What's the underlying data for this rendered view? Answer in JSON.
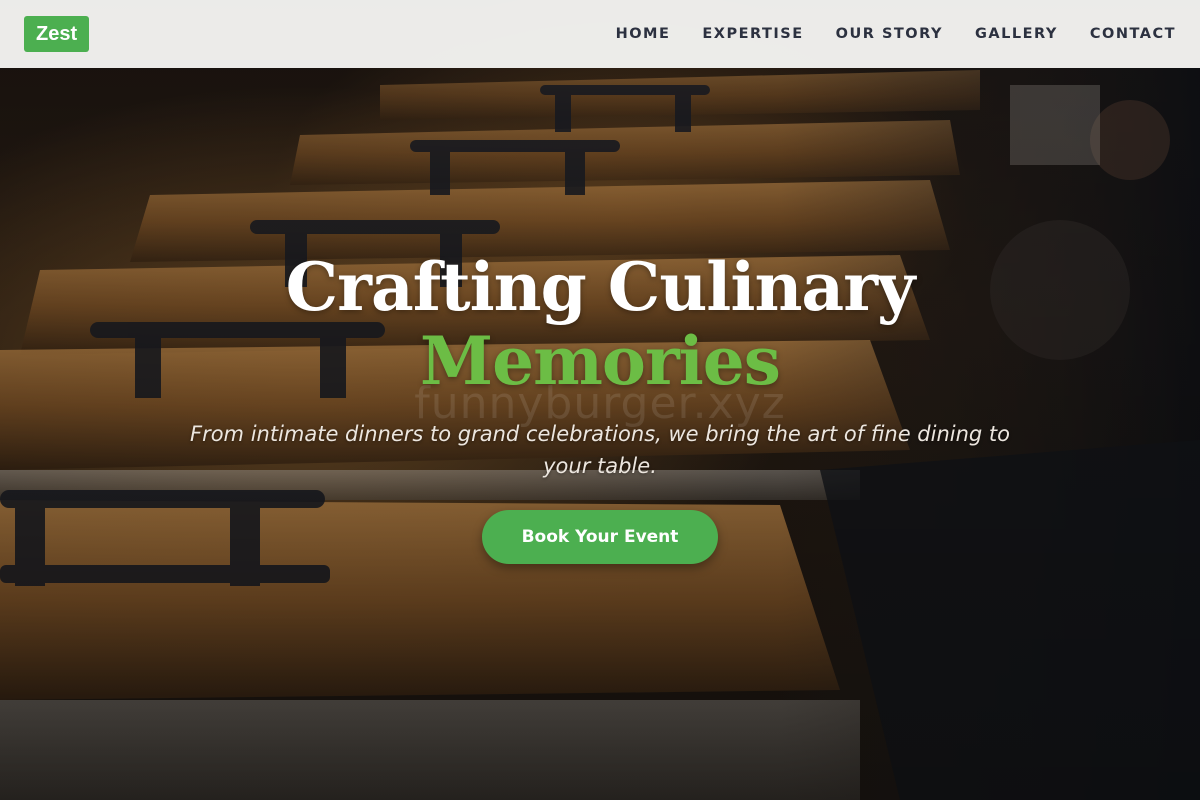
{
  "brand": {
    "logo_text": "Zest",
    "accent_color": "#4caf50"
  },
  "nav": {
    "items": [
      {
        "label": "HOME"
      },
      {
        "label": "EXPERTISE"
      },
      {
        "label": "OUR STORY"
      },
      {
        "label": "GALLERY"
      },
      {
        "label": "CONTACT"
      }
    ]
  },
  "hero": {
    "headline_line1": "Crafting Culinary",
    "headline_line2": "Memories",
    "headline_accent_color": "#6cbd45",
    "subtitle": "From intimate dinners to grand celebrations, we bring the art of fine dining to your table.",
    "cta_label": "Book Your Event",
    "watermark": "funnyburger.xyz",
    "background_description_icon": "chafing-dishes-image"
  }
}
